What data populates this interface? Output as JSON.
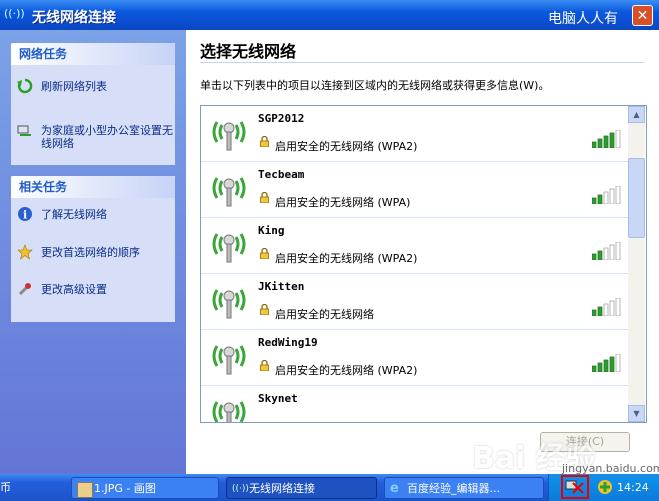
{
  "window": {
    "title": "无线网络连接",
    "watermark": "电脑人人有",
    "close_glyph": "✕"
  },
  "left": {
    "network_tasks": {
      "title": "网络任务",
      "items": [
        "刷新网络列表",
        "为家庭或小型办公室设置无线网络"
      ]
    },
    "related_tasks": {
      "title": "相关任务",
      "items": [
        "了解无线网络",
        "更改首选网络的顺序",
        "更改高级设置"
      ]
    }
  },
  "main": {
    "heading": "选择无线网络",
    "description": "单击以下列表中的项目以连接到区域内的无线网络或获得更多信息(W)。",
    "networks": [
      {
        "name": "SGP2012",
        "status": "启用安全的无线网络 (WPA2)",
        "signal": 4
      },
      {
        "name": "Tecbeam",
        "status": "启用安全的无线网络 (WPA)",
        "signal": 2
      },
      {
        "name": "King",
        "status": "启用安全的无线网络 (WPA2)",
        "signal": 2
      },
      {
        "name": "JKitten",
        "status": "启用安全的无线网络",
        "signal": 2
      },
      {
        "name": "RedWing19",
        "status": "启用安全的无线网络 (WPA2)",
        "signal": 4
      },
      {
        "name": "Skynet",
        "status": "",
        "signal": 0
      }
    ],
    "connect_label": "连接(C)"
  },
  "taskbar": {
    "start_fragment": "币",
    "buttons": [
      "1.JPG - 画图",
      "无线网络连接",
      "百度经验_编辑器..."
    ],
    "clock": "14:24",
    "watermark": "Bai 经验",
    "watermark_url": "jingyan.baidu.com"
  },
  "colors": {
    "accent": "#215dc6",
    "signal_on": "#2f9e2f",
    "signal_off": "#c8c8c8"
  }
}
